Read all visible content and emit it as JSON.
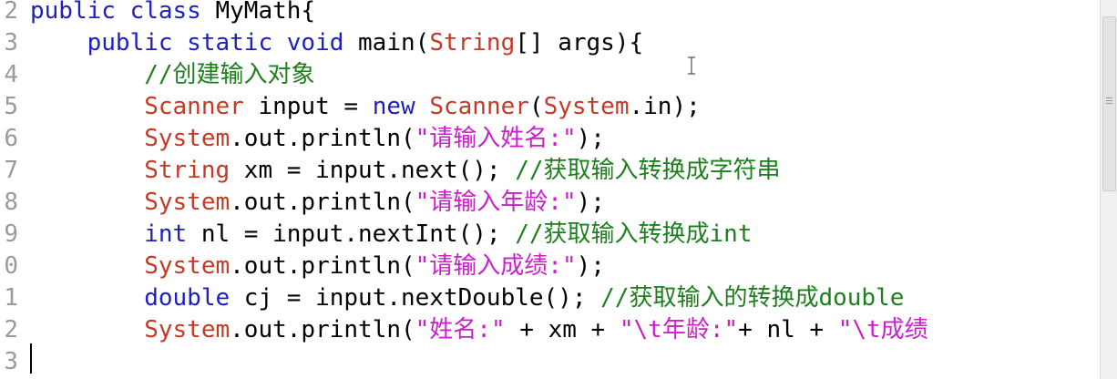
{
  "editor": {
    "lines": [
      {
        "num": "2",
        "parts": [
          {
            "t": "public class ",
            "c": "kw"
          },
          {
            "t": "MyMath{",
            "c": "plain"
          }
        ]
      },
      {
        "num": "3",
        "parts": [
          {
            "t": "    public static void ",
            "c": "kw"
          },
          {
            "t": "main(",
            "c": "plain"
          },
          {
            "t": "String",
            "c": "cls"
          },
          {
            "t": "[] args){",
            "c": "plain"
          }
        ]
      },
      {
        "num": "4",
        "parts": [
          {
            "t": "        //创建输入对象",
            "c": "cmt"
          }
        ]
      },
      {
        "num": "5",
        "parts": [
          {
            "t": "        Scanner",
            "c": "cls"
          },
          {
            "t": " input = ",
            "c": "plain"
          },
          {
            "t": "new ",
            "c": "kw"
          },
          {
            "t": "Scanner",
            "c": "cls"
          },
          {
            "t": "(",
            "c": "plain"
          },
          {
            "t": "System",
            "c": "cls"
          },
          {
            "t": ".in);",
            "c": "plain"
          }
        ]
      },
      {
        "num": "6",
        "parts": [
          {
            "t": "        System",
            "c": "cls"
          },
          {
            "t": ".out.println(",
            "c": "plain"
          },
          {
            "t": "\"请输入姓名:\"",
            "c": "str"
          },
          {
            "t": ");",
            "c": "plain"
          }
        ]
      },
      {
        "num": "7",
        "parts": [
          {
            "t": "        String",
            "c": "cls"
          },
          {
            "t": " xm = input.next(); ",
            "c": "plain"
          },
          {
            "t": "//获取输入转换成字符串",
            "c": "cmt"
          }
        ]
      },
      {
        "num": "8",
        "parts": [
          {
            "t": "        System",
            "c": "cls"
          },
          {
            "t": ".out.println(",
            "c": "plain"
          },
          {
            "t": "\"请输入年龄:\"",
            "c": "str"
          },
          {
            "t": ");",
            "c": "plain"
          }
        ]
      },
      {
        "num": "9",
        "parts": [
          {
            "t": "        int",
            "c": "kw"
          },
          {
            "t": " nl = input.nextInt(); ",
            "c": "plain"
          },
          {
            "t": "//获取输入转换成int",
            "c": "cmt"
          }
        ]
      },
      {
        "num": "0",
        "parts": [
          {
            "t": "        System",
            "c": "cls"
          },
          {
            "t": ".out.println(",
            "c": "plain"
          },
          {
            "t": "\"请输入成绩:\"",
            "c": "str"
          },
          {
            "t": ");",
            "c": "plain"
          }
        ]
      },
      {
        "num": "1",
        "parts": [
          {
            "t": "        double",
            "c": "kw"
          },
          {
            "t": " cj = input.nextDouble(); ",
            "c": "plain"
          },
          {
            "t": "//获取输入的转换成double",
            "c": "cmt"
          }
        ]
      },
      {
        "num": "2",
        "parts": [
          {
            "t": "        System",
            "c": "cls"
          },
          {
            "t": ".out.println(",
            "c": "plain"
          },
          {
            "t": "\"姓名:\"",
            "c": "str"
          },
          {
            "t": " + xm + ",
            "c": "plain"
          },
          {
            "t": "\"\\t年龄:\"",
            "c": "str"
          },
          {
            "t": "+ nl + ",
            "c": "plain"
          },
          {
            "t": "\"\\t成绩",
            "c": "str"
          }
        ]
      },
      {
        "num": "3",
        "parts": []
      }
    ]
  }
}
